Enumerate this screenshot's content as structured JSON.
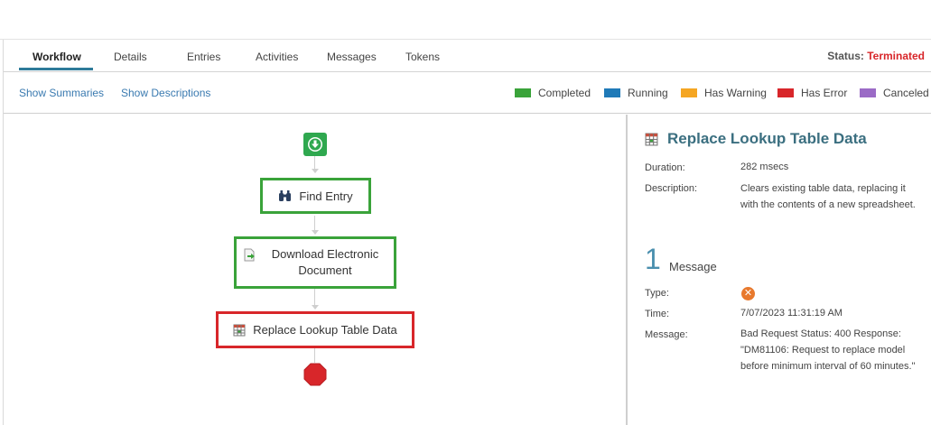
{
  "tabs": [
    {
      "label": "Workflow",
      "active": true
    },
    {
      "label": "Details"
    },
    {
      "label": "Entries"
    },
    {
      "label": "Activities"
    },
    {
      "label": "Messages"
    },
    {
      "label": "Tokens"
    }
  ],
  "status": {
    "label": "Status:",
    "value": "Terminated",
    "color": "#d8262a"
  },
  "links": {
    "summaries": "Show Summaries",
    "descriptions": "Show Descriptions"
  },
  "legend": [
    {
      "label": "Completed",
      "color": "#3aa33a"
    },
    {
      "label": "Running",
      "color": "#1f7ab8"
    },
    {
      "label": "Has Warning",
      "color": "#f5a623"
    },
    {
      "label": "Has Error",
      "color": "#d8262a"
    },
    {
      "label": "Canceled",
      "color": "#9b6bc6"
    }
  ],
  "workflow": {
    "start_icon": "download-arrow-icon",
    "end_icon": "stop-octagon-icon",
    "nodes": [
      {
        "label": "Find Entry",
        "icon": "binoculars-icon",
        "state": "completed"
      },
      {
        "label": "Download Electronic Document",
        "icon": "document-arrow-icon",
        "state": "completed"
      },
      {
        "label": "Replace Lookup Table Data",
        "icon": "table-icon",
        "state": "error"
      }
    ]
  },
  "details": {
    "title": "Replace Lookup Table Data",
    "duration_label": "Duration:",
    "duration_value": "282 msecs",
    "description_label": "Description:",
    "description_value": "Clears existing table data, replacing it with the contents of a new spreadsheet.",
    "message_count": "1",
    "message_heading": "Message",
    "type_label": "Type:",
    "type_icon": "error-x-icon",
    "time_label": "Time:",
    "time_value": "7/07/2023 11:31:19 AM",
    "message_label": "Message:",
    "message_value": "Bad Request Status: 400 Response: \"DM81106: Request to replace model before minimum interval of 60 minutes.\""
  }
}
